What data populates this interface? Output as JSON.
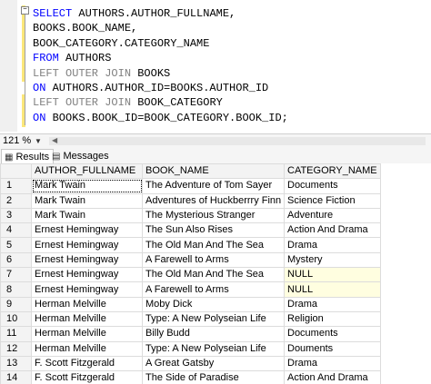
{
  "editor": {
    "lines": [
      [
        {
          "t": "SELECT",
          "c": "kw"
        },
        {
          "t": " AUTHORS.AUTHOR_FULLNAME,",
          "c": ""
        }
      ],
      [
        {
          "t": "BOOKS.BOOK_NAME,",
          "c": ""
        }
      ],
      [
        {
          "t": "BOOK_CATEGORY.CATEGORY_NAME",
          "c": ""
        }
      ],
      [
        {
          "t": "FROM",
          "c": "kw"
        },
        {
          "t": " AUTHORS",
          "c": ""
        }
      ],
      [
        {
          "t": "LEFT OUTER JOIN",
          "c": "gr"
        },
        {
          "t": " BOOKS",
          "c": ""
        }
      ],
      [
        {
          "t": "ON",
          "c": "kw"
        },
        {
          "t": " AUTHORS.AUTHOR_ID=BOOKS.AUTHOR_ID",
          "c": ""
        }
      ],
      [
        {
          "t": "LEFT OUTER JOIN",
          "c": "gr"
        },
        {
          "t": " BOOK_CATEGORY",
          "c": ""
        }
      ],
      [
        {
          "t": "ON",
          "c": "kw"
        },
        {
          "t": " BOOKS.BOOK_ID=BOOK_CATEGORY.BOOK_ID;",
          "c": ""
        }
      ]
    ]
  },
  "statusbar": {
    "zoom": "121 %"
  },
  "tabs": {
    "results": "Results",
    "messages": "Messages"
  },
  "grid": {
    "columns": [
      "AUTHOR_FULLNAME",
      "BOOK_NAME",
      "CATEGORY_NAME"
    ],
    "rows": [
      [
        "1",
        "Mark Twain",
        "The Adventure of Tom Sayer",
        "Documents"
      ],
      [
        "2",
        "Mark Twain",
        "Adventures of Huckberrry Finn",
        "Science Fiction"
      ],
      [
        "3",
        "Mark Twain",
        "The Mysterious Stranger",
        "Adventure"
      ],
      [
        "4",
        "Ernest Hemingway",
        "The Sun Also Rises",
        "Action And Drama"
      ],
      [
        "5",
        "Ernest Hemingway",
        "The Old Man And The Sea",
        "Drama"
      ],
      [
        "6",
        "Ernest Hemingway",
        "A Farewell to Arms",
        "Mystery"
      ],
      [
        "7",
        "Ernest Hemingway",
        "The Old Man And The Sea",
        "NULL"
      ],
      [
        "8",
        "Ernest Hemingway",
        "A Farewell to Arms",
        "NULL"
      ],
      [
        "9",
        "Herman Melville",
        "Moby Dick",
        "Drama"
      ],
      [
        "10",
        "Herman Melville",
        "Type: A New Polyseian Life",
        "Religion"
      ],
      [
        "11",
        "Herman Melville",
        "Billy Budd",
        "Documents"
      ],
      [
        "12",
        "Herman Melville",
        "Type: A New Polyseian Life",
        "Douments"
      ],
      [
        "13",
        "F. Scott Fitzgerald",
        "A Great Gatsby",
        "Drama"
      ],
      [
        "14",
        "F. Scott Fitzgerald",
        "The Side of Paradise",
        "Action And Drama"
      ]
    ]
  }
}
